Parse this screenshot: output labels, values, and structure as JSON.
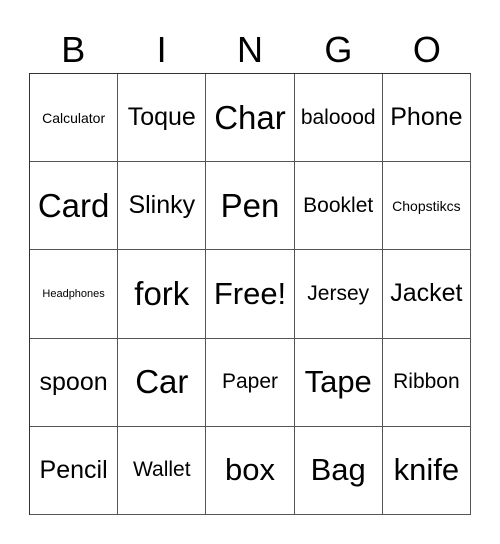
{
  "header": {
    "letters": [
      "B",
      "I",
      "N",
      "G",
      "O"
    ]
  },
  "card": {
    "rows": [
      [
        {
          "label": "Calculator",
          "size": "s"
        },
        {
          "label": "Toque",
          "size": "m"
        },
        {
          "label": "Char",
          "size": "xl"
        },
        {
          "label": "baloood",
          "size": "ms"
        },
        {
          "label": "Phone",
          "size": "m"
        }
      ],
      [
        {
          "label": "Card",
          "size": "xl"
        },
        {
          "label": "Slinky",
          "size": "m"
        },
        {
          "label": "Pen",
          "size": "xl"
        },
        {
          "label": "Booklet",
          "size": "ms"
        },
        {
          "label": "Chopstikcs",
          "size": "s"
        }
      ],
      [
        {
          "label": "Headphones",
          "size": "xs"
        },
        {
          "label": "fork",
          "size": "xl"
        },
        {
          "label": "Free!",
          "size": "l"
        },
        {
          "label": "Jersey",
          "size": "ms"
        },
        {
          "label": "Jacket",
          "size": "m"
        }
      ],
      [
        {
          "label": "spoon",
          "size": "m"
        },
        {
          "label": "Car",
          "size": "xl"
        },
        {
          "label": "Paper",
          "size": "ms"
        },
        {
          "label": "Tape",
          "size": "l"
        },
        {
          "label": "Ribbon",
          "size": "ms"
        }
      ],
      [
        {
          "label": "Pencil",
          "size": "m"
        },
        {
          "label": "Wallet",
          "size": "ms"
        },
        {
          "label": "box",
          "size": "l"
        },
        {
          "label": "Bag",
          "size": "l"
        },
        {
          "label": "knife",
          "size": "l"
        }
      ]
    ]
  }
}
